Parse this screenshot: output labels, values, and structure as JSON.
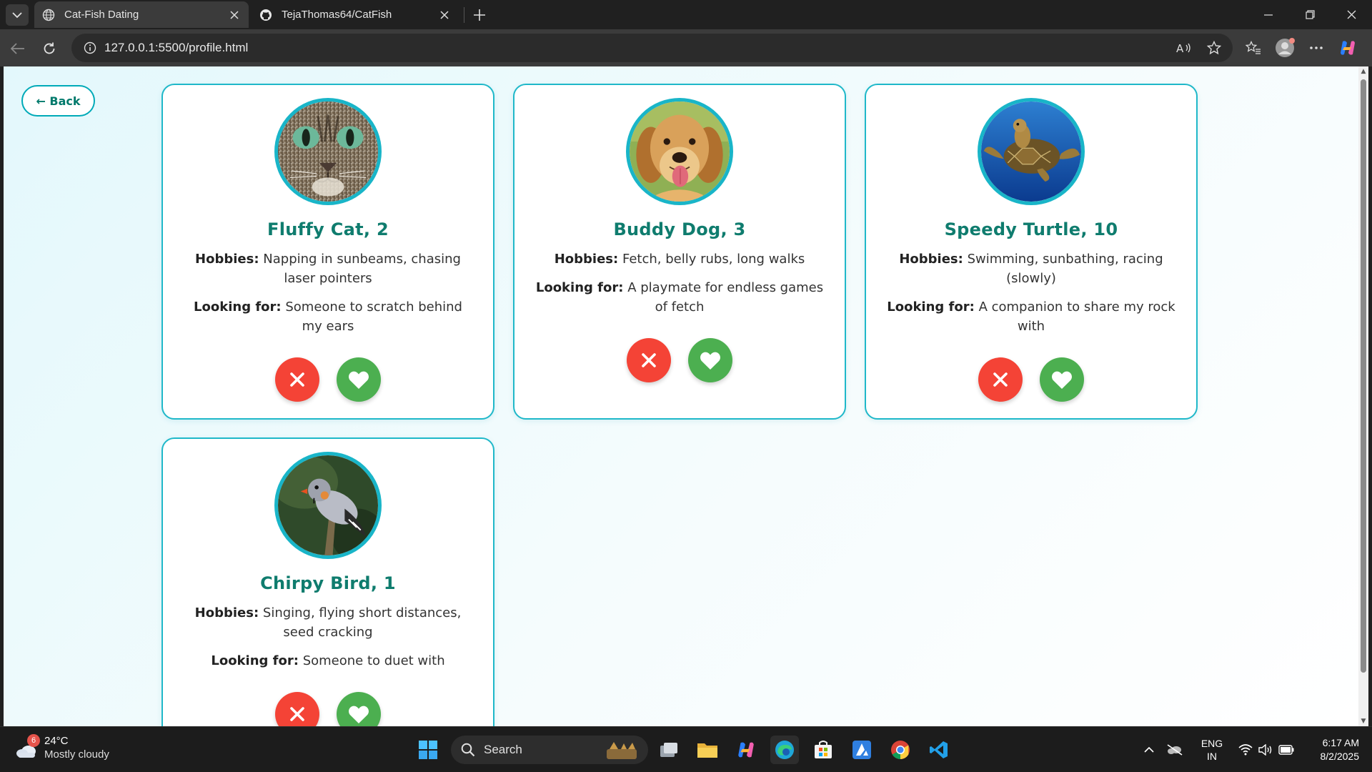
{
  "browser": {
    "tabs": [
      {
        "title": "Cat-Fish Dating",
        "icon": "globe-icon",
        "active": true
      },
      {
        "title": "TejaThomas64/CatFish",
        "icon": "github-icon",
        "active": false
      }
    ],
    "url": "127.0.0.1:5500/profile.html"
  },
  "page": {
    "back_label": "← Back",
    "hobbies_label": "Hobbies:",
    "looking_label": "Looking for:",
    "profiles": [
      {
        "name": "Fluffy Cat, 2",
        "hobbies": "Napping in sunbeams, chasing laser pointers",
        "looking_for": "Someone to scratch behind my ears",
        "photo": "cat-photo"
      },
      {
        "name": "Buddy Dog, 3",
        "hobbies": "Fetch, belly rubs, long walks",
        "looking_for": "A playmate for endless games of fetch",
        "photo": "dog-photo"
      },
      {
        "name": "Speedy Turtle, 10",
        "hobbies": "Swimming, sunbathing, racing (slowly)",
        "looking_for": "A companion to share my rock with",
        "photo": "turtle-photo"
      },
      {
        "name": "Chirpy Bird, 1",
        "hobbies": "Singing, flying short distances, seed cracking",
        "looking_for": "Someone to duet with",
        "photo": "bird-photo"
      }
    ],
    "colors": {
      "accent": "#1fb8c9",
      "name": "#0f7c6e",
      "reject": "#f44336",
      "like": "#4caf50"
    }
  },
  "taskbar": {
    "weather": {
      "temp": "24°C",
      "condition": "Mostly cloudy",
      "badge": "6"
    },
    "search_label": "Search",
    "lang": {
      "line1": "ENG",
      "line2": "IN"
    },
    "clock": {
      "time": "6:17 AM",
      "date": "8/2/2025"
    }
  }
}
